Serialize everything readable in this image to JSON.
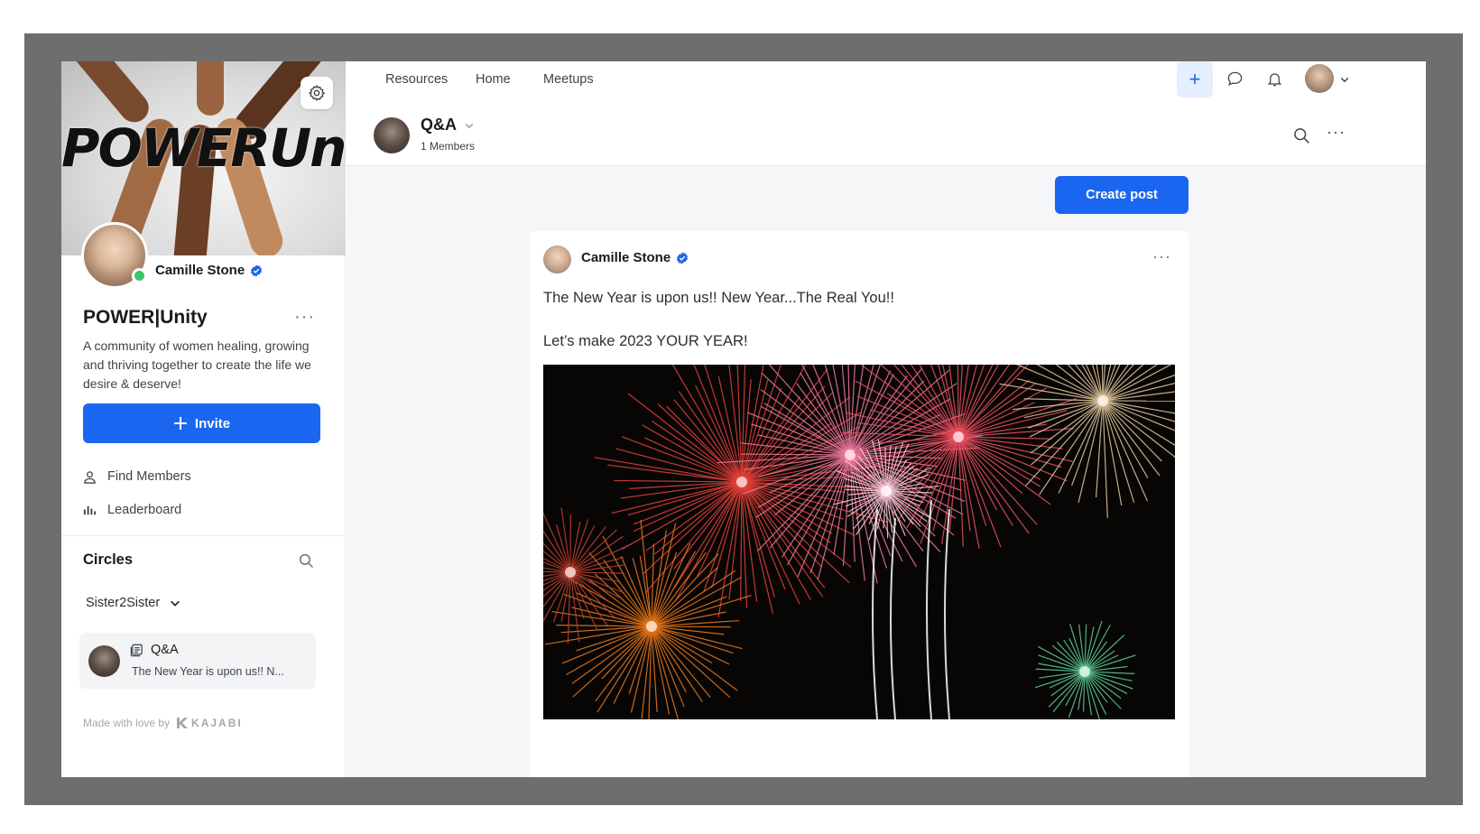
{
  "sidebar": {
    "banner_logo": "POWERUnity",
    "owner_name": "Camille Stone",
    "group_title": "POWER|Unity",
    "group_more": "···",
    "group_description": "A community of women healing, growing and thriving together to create the life we desire & deserve!",
    "invite_label": "Invite",
    "links": [
      {
        "label": "Find Members",
        "icon": "person-icon"
      },
      {
        "label": "Leaderboard",
        "icon": "bar-chart-icon"
      }
    ],
    "circles_title": "Circles",
    "circle_selected": "Sister2Sister",
    "circle_item": {
      "name": "Q&A",
      "preview": "The New Year is upon us!! N..."
    },
    "made_with": "Made with love by",
    "brand": "KAJABI"
  },
  "topnav": {
    "links": [
      "Resources",
      "Home",
      "Meetups"
    ],
    "plus": "+"
  },
  "space": {
    "title": "Q&A",
    "members": "1 Members",
    "more": "···"
  },
  "actions": {
    "create_post": "Create post"
  },
  "post": {
    "author": "Camille Stone",
    "more": "···",
    "line1": "The New Year is upon us!! New Year...The Real You!!",
    "line2": "Let’s make 2023 YOUR YEAR!"
  },
  "colors": {
    "accent": "#1a66f0",
    "online": "#3cc46a",
    "frame": "#6e6e6e"
  }
}
